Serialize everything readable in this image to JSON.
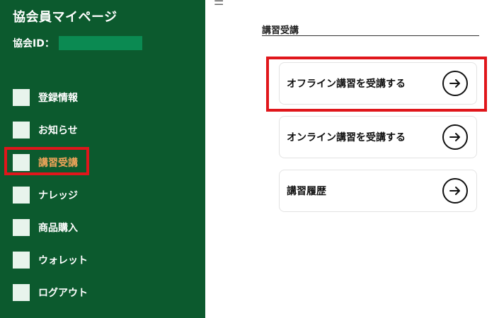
{
  "sidebar": {
    "title": "協会員マイページ",
    "member_id_label": "協会ID：",
    "member_id_value": "",
    "items": [
      {
        "label": "登録情報"
      },
      {
        "label": "お知らせ"
      },
      {
        "label": "講習受講"
      },
      {
        "label": "ナレッジ"
      },
      {
        "label": "商品購入"
      },
      {
        "label": "ウォレット"
      },
      {
        "label": "ログアウト"
      }
    ],
    "active_item": "講習受講"
  },
  "header": {
    "menu_icon": "hamburger-menu-icon"
  },
  "main": {
    "section_title": "講習受講",
    "cards": [
      {
        "label": "オフライン講習を受講する",
        "icon": "arrow-right-circle-icon"
      },
      {
        "label": "オンライン講習を受講する",
        "icon": "arrow-right-circle-icon"
      },
      {
        "label": "講習履歴",
        "icon": "arrow-right-circle-icon"
      }
    ]
  },
  "colors": {
    "sidebar_bg": "#0c5a2e",
    "active_text": "#f2a55a",
    "highlight_border": "#e0161b",
    "id_mask": "#0b8a52"
  }
}
